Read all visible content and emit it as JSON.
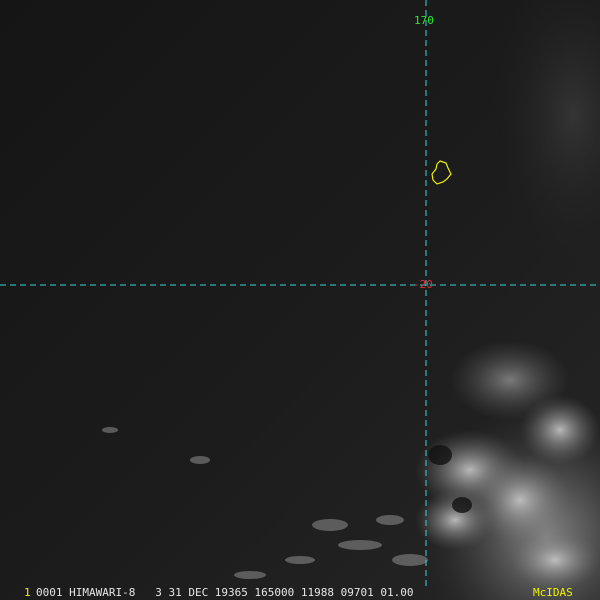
{
  "image": {
    "satellite_text": "0001 HIMAWARI-8   3 31 DEC 19365 165000 11988 09701 01.00",
    "frame_number": "1",
    "brand": "McIDAS"
  },
  "grid": {
    "longitude_label": "170",
    "latitude_label": "-20",
    "line_color": "#33d6d6",
    "lon_label_color": "#2ee62e",
    "lat_label_color": "#e63030"
  },
  "overlay": {
    "coastline_color": "#f0f000",
    "footer_number_color": "#f0f000"
  }
}
